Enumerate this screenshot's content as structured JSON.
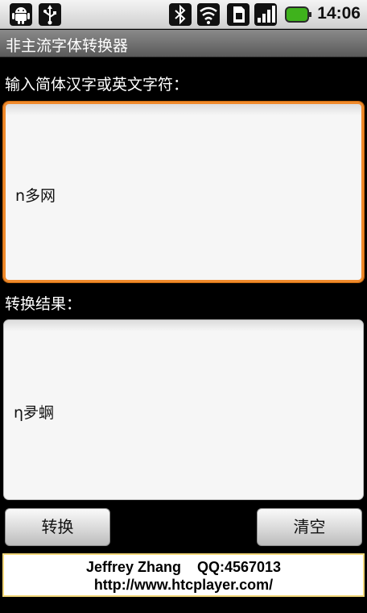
{
  "status_bar": {
    "time": "14:06",
    "icons": [
      "android-icon",
      "usb-icon",
      "bluetooth-icon",
      "wifi-icon",
      "sim-icon",
      "signal-icon",
      "battery-icon"
    ],
    "battery_color": "#3fb21c"
  },
  "app": {
    "title": "非主流字体转换器"
  },
  "input": {
    "label": "输入简体汉字或英文字符：",
    "value": "n多网"
  },
  "result": {
    "label": "转换结果：",
    "value": "η夛蛧"
  },
  "buttons": {
    "convert": "转换",
    "clear": "清空"
  },
  "footer": {
    "line1": "Jeffrey Zhang    QQ:4567013",
    "line2": "http://www.htcplayer.com/"
  },
  "colors": {
    "focus_border": "#f08a2c",
    "footer_border": "#f2d77a"
  }
}
